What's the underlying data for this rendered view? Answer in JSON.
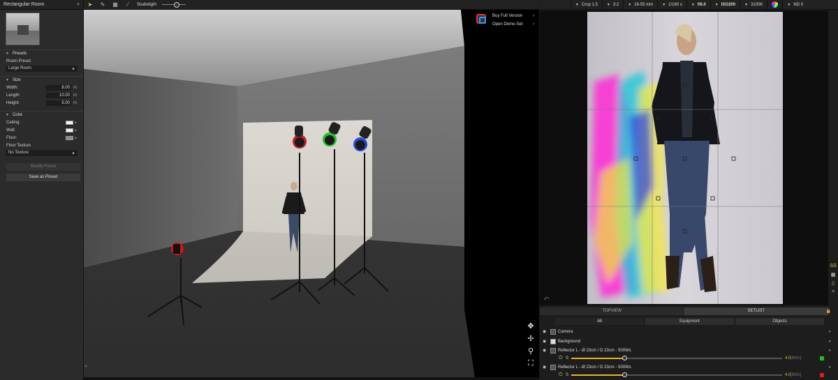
{
  "left_panel": {
    "title": "Rectangular Room",
    "sections": {
      "presets": "Presets",
      "size": "Size",
      "color": "Color"
    },
    "room_preset_label": "Room Preset",
    "room_preset_value": "Large Room",
    "size": {
      "width_label": "Width:",
      "width_value": "8.00",
      "length_label": "Length:",
      "length_value": "10.00",
      "height_label": "Height:",
      "height_value": "5.00",
      "unit": "m"
    },
    "color": {
      "ceiling_label": "Ceiling:",
      "ceiling_color": "#f4f4f4",
      "wall_label": "Wall:",
      "wall_color": "#f0f0f0",
      "floor_label": "Floor:",
      "floor_color": "#8a8a8a"
    },
    "floor_texture_label": "Floor Texture",
    "floor_texture_value": "No Texture",
    "modify_preset": "Modify Preset",
    "save_as_preset": "Save as Preset"
  },
  "viewport": {
    "light_mode_label": "Studiolight",
    "promo": {
      "buy": "Buy Full Version",
      "demo": "Open Demo-Set"
    }
  },
  "camera_bar": {
    "crop": "Crop 1.5",
    "aspect": "3:2",
    "lens": "16-55 mm",
    "shutter": "1/160 s",
    "aperture": "f/8.0",
    "iso": "ISO200",
    "white_balance": "3100K",
    "nd": "ND 0"
  },
  "view_tabs": {
    "topview": "TOPVIEW",
    "setlist": "SETLIST"
  },
  "filter_tabs": {
    "all": "All",
    "equipment": "Equipment",
    "objects": "Objects"
  },
  "setlist": {
    "camera": "Camera",
    "background": "Background",
    "light1": {
      "name": "Reflector L - Ø 23cm / D 23cm - 500Ws",
      "power": 4.0,
      "power_label": "4.0",
      "ws_label": "[8Ws]",
      "color": "#1fbf2a",
      "slider_label": "S"
    },
    "light2": {
      "name": "Reflector L - Ø 23cm / D 23cm - 500Ws",
      "power": 4.0,
      "power_label": "4.0",
      "ws_label": "[8Ws]",
      "color": "#e01b1b",
      "slider_label": "S"
    }
  }
}
